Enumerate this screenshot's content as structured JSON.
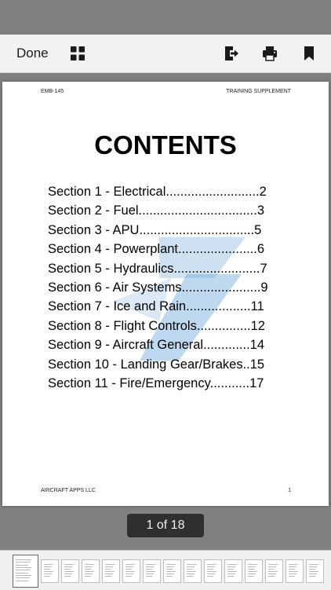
{
  "toolbar": {
    "done_label": "Done",
    "icons": [
      "grid-icon",
      "share-export-icon",
      "print-icon",
      "bookmark-icon"
    ]
  },
  "document": {
    "header_left": "EMB-145",
    "header_right": "TRAINING SUPPLEMENT",
    "title": "CONTENTS",
    "toc": [
      "Section 1 - Electrical..........................2",
      "Section 2 - Fuel.................................3",
      "Section 3 - APU................................5",
      "Section 4 - Powerplant......................6",
      "Section 5 - Hydraulics........................7",
      "Section 6 - Air Systems......................9",
      "Section 7 - Ice and Rain..................11",
      "Section 8 - Flight Controls...............12",
      "Section 9 - Aircraft General.............14",
      "Section 10 - Landing Gear/Brakes..15",
      "Section 11 - Fire/Emergency...........17"
    ],
    "footer_left": "AIRCRAFT APPS LLC",
    "footer_right": "1"
  },
  "pager": {
    "indicator": "1 of 18"
  },
  "thumbnails": {
    "count": 15,
    "active_index": 0
  },
  "colors": {
    "toolbar_bg": "#f2f2f2",
    "viewer_bg": "#808080",
    "watermark": "#6fa8dc",
    "indicator_bg": "#2f2f2f"
  }
}
